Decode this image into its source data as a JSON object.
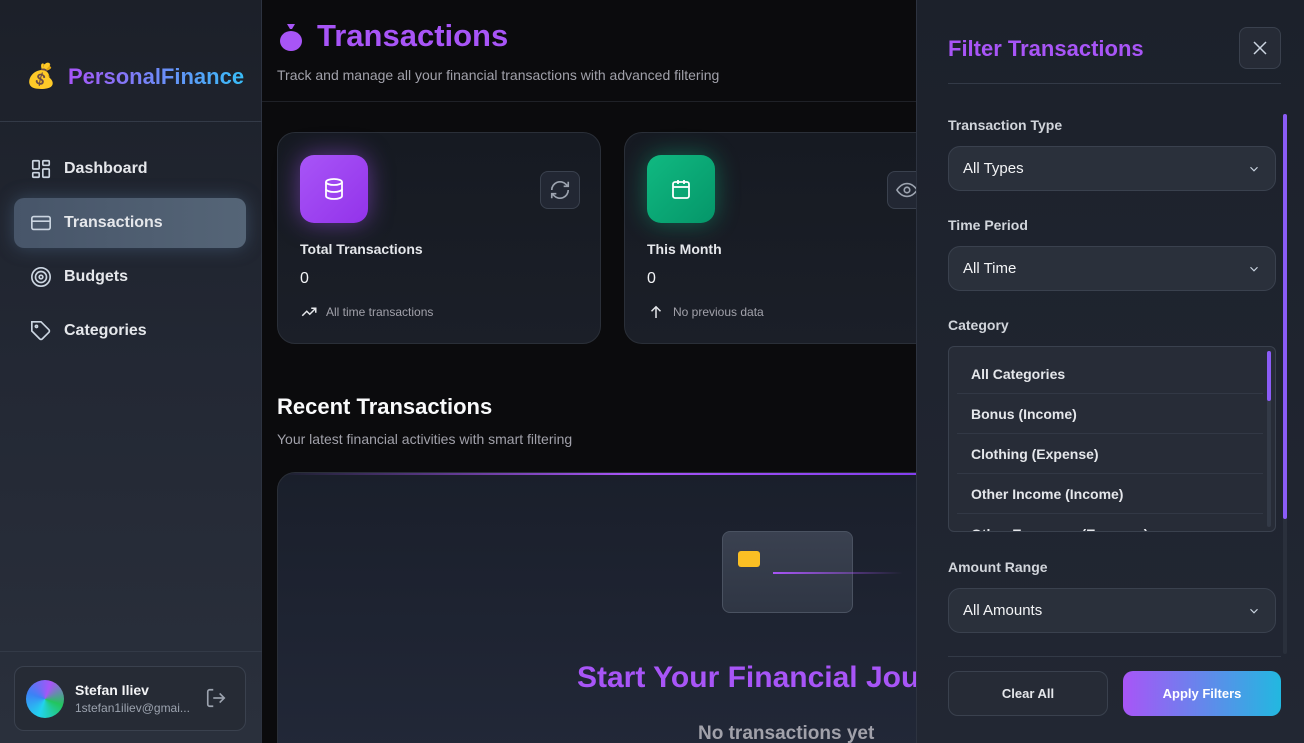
{
  "sidebar": {
    "brand": {
      "icon": "money-bag-icon",
      "name": "PersonalFinance"
    },
    "items": [
      {
        "label": "Dashboard",
        "icon": "dashboard-icon"
      },
      {
        "label": "Transactions",
        "icon": "card-icon",
        "active": true
      },
      {
        "label": "Budgets",
        "icon": "target-icon"
      },
      {
        "label": "Categories",
        "icon": "tag-icon"
      }
    ],
    "user": {
      "name": "Stefan Iliev",
      "email": "1stefan1iliev@gmai..."
    }
  },
  "header": {
    "title": "Transactions",
    "subtitle": "Track and manage all your financial transactions with advanced filtering"
  },
  "stats": [
    {
      "label": "Total Transactions",
      "value": "0",
      "foot": "All time transactions",
      "color": "#a855f7"
    },
    {
      "label": "This Month",
      "value": "0",
      "foot": "No previous data",
      "color": "#10b981"
    }
  ],
  "recent": {
    "title": "Recent Transactions",
    "subtitle": "Your latest financial activities with smart filtering",
    "empty_title": "Start Your Financial Jou",
    "empty_sub": "No transactions yet"
  },
  "filter": {
    "title": "Filter Transactions",
    "type_label": "Transaction Type",
    "type_value": "All Types",
    "period_label": "Time Period",
    "period_value": "All Time",
    "category_label": "Category",
    "categories": [
      "All Categories",
      "Bonus (Income)",
      "Clothing (Expense)",
      "Other Income (Income)",
      "Other Expenses (Expense)"
    ],
    "amount_label": "Amount Range",
    "amount_value": "All Amounts",
    "clear_label": "Clear All",
    "apply_label": "Apply Filters"
  }
}
